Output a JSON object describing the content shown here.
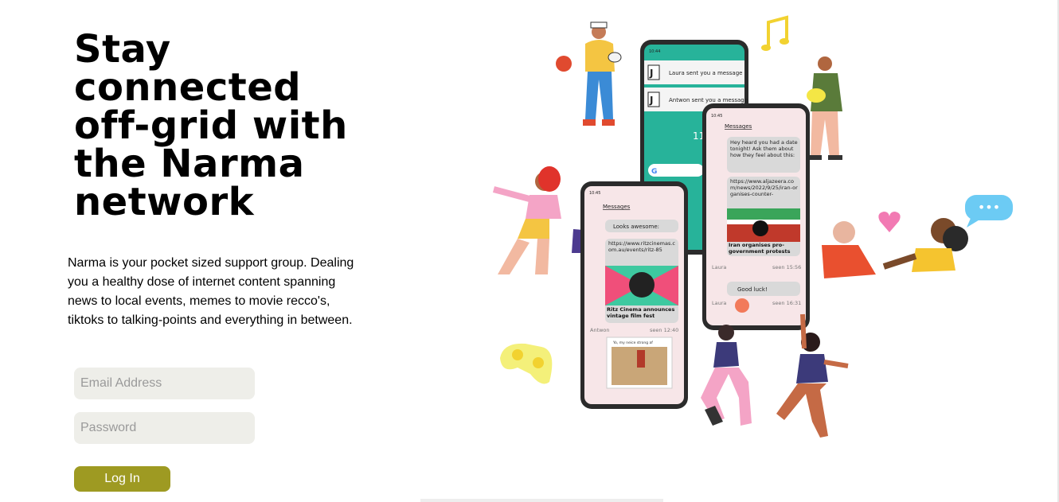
{
  "hero": {
    "headline": "Stay connected off-grid with the Narma network",
    "description": "Narma is your pocket sized support group. Dealing you a healthy dose of internet content spanning news to local events, memes to movie recco's, tiktoks to talking-points and everything in between."
  },
  "login_form": {
    "email_placeholder": "Email Address",
    "password_placeholder": "Password",
    "login_label": "Log In"
  },
  "illustration": {
    "phone_back": {
      "status_time": "10:44",
      "notifications": [
        {
          "avatar": "J",
          "text": "Laura sent you a message"
        },
        {
          "avatar": "J",
          "text": "Antwon sent you a message"
        }
      ],
      "clock": "11"
    },
    "phone_right": {
      "status_time": "10:45",
      "header": "Messages",
      "bubble_1": "Hey heard you had a date tonight! Ask them about how they feel about this:",
      "link_bubble": "https://www.aljazeera.com/news/2022/9/25/iran-organises-counter-",
      "link_title": "Iran organises pro-government protests",
      "sender": "Laura",
      "seen_1": "seen 15:56",
      "bubble_2": "Good luck!",
      "seen_2": "seen 16:31"
    },
    "phone_left": {
      "status_time": "10:45",
      "header": "Messages",
      "bubble_1": "Looks awesome:",
      "link_bubble": "https://www.ritzcinemas.com.au/events/ritz-85",
      "link_title": "Ritz Cinema announces vintage film fest",
      "sender": "Antwon",
      "seen": "seen 12:40",
      "meme_caption": "Yo, my neice strong af"
    },
    "chat_bubble_dots": "•••",
    "colors": {
      "accent": "#9e9a22",
      "field_bg": "#eeeee9",
      "phone_frame": "#2b2b2b",
      "screen_teal": "#27b39a"
    }
  }
}
